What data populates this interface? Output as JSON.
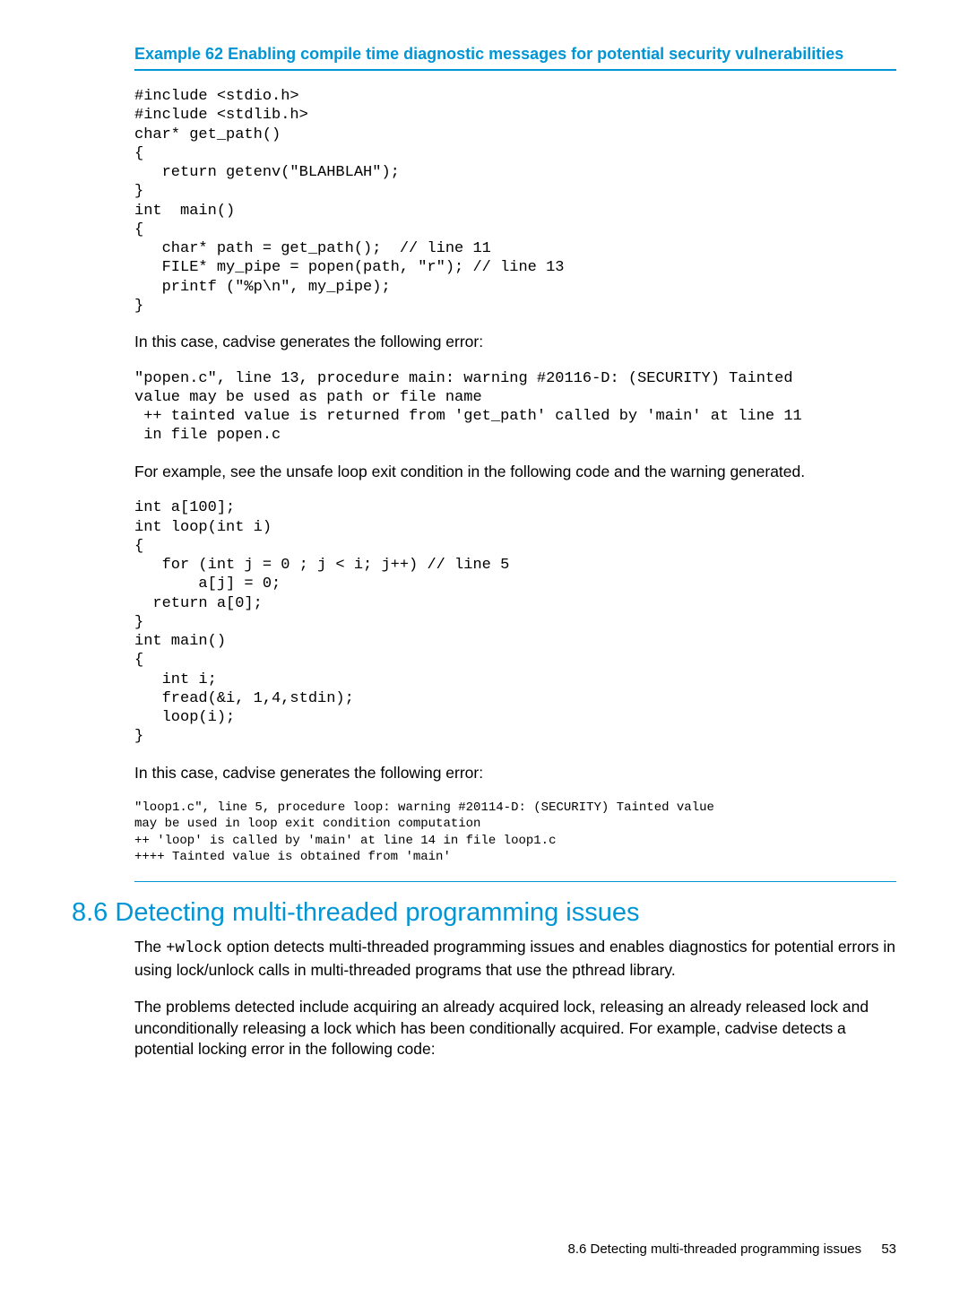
{
  "example": {
    "title": "Example 62 Enabling compile time diagnostic messages for potential security vulnerabilities",
    "code1": "#include <stdio.h>\n#include <stdlib.h>\nchar* get_path()\n{\n   return getenv(\"BLAHBLAH\");\n}\nint  main()\n{\n   char* path = get_path();  // line 11\n   FILE* my_pipe = popen(path, \"r\"); // line 13\n   printf (\"%p\\n\", my_pipe);\n}",
    "desc1": "In this case, cadvise generates the following error:",
    "err1": "\"popen.c\", line 13, procedure main: warning #20116-D: (SECURITY) Tainted\nvalue may be used as path or file name\n ++ tainted value is returned from 'get_path' called by 'main' at line 11\n in file popen.c",
    "desc2": "For example, see the unsafe loop exit condition in the following code and the warning generated.",
    "code2": "int a[100];\nint loop(int i)\n{\n   for (int j = 0 ; j < i; j++) // line 5\n       a[j] = 0;\n  return a[0];\n}\nint main()\n{\n   int i;\n   fread(&i, 1,4,stdin);\n   loop(i);\n}",
    "desc3": "In this case, cadvise generates the following error:",
    "err2": "\"loop1.c\", line 5, procedure loop: warning #20114-D: (SECURITY) Tainted value\nmay be used in loop exit condition computation\n++ 'loop' is called by 'main' at line 14 in file loop1.c\n++++ Tainted value is obtained from 'main'"
  },
  "section": {
    "heading": "8.6 Detecting multi-threaded programming issues",
    "para1_pre": "The ",
    "para1_code": "+wlock",
    "para1_post": " option detects multi-threaded programming issues and enables diagnostics for potential errors in using lock/unlock calls in multi-threaded programs that use the pthread library.",
    "para2": "The problems detected include acquiring an already acquired lock, releasing an already released lock and unconditionally releasing a lock which has been conditionally acquired. For example, cadvise detects a potential locking error in the following code:"
  },
  "footer": {
    "text": "8.6 Detecting multi-threaded programming issues",
    "page": "53"
  }
}
